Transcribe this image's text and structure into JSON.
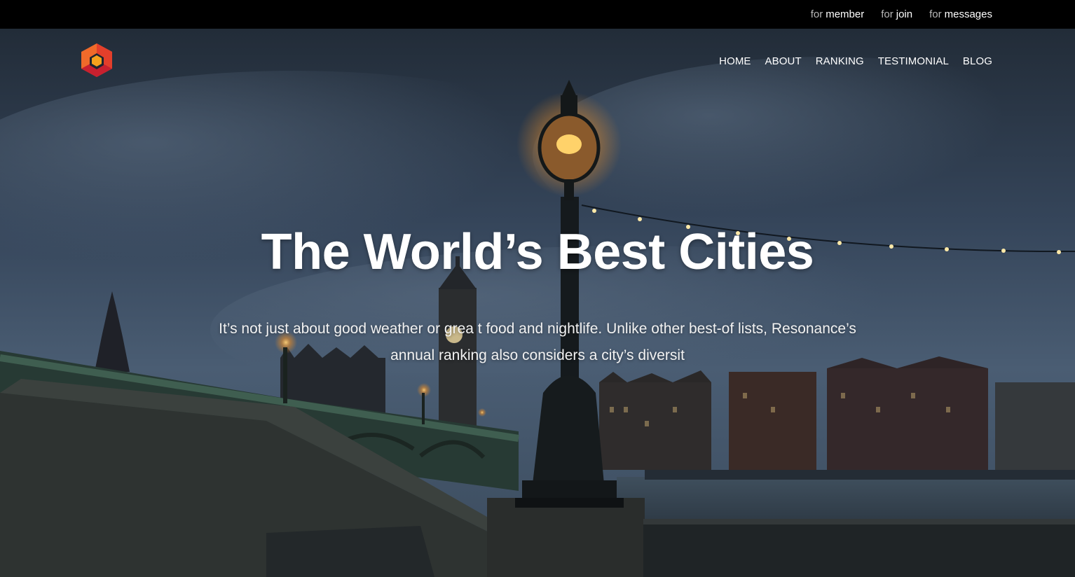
{
  "topbar": {
    "links": [
      {
        "prefix": "for",
        "label": "member"
      },
      {
        "prefix": "for",
        "label": "join"
      },
      {
        "prefix": "for",
        "label": "messages"
      }
    ]
  },
  "nav": {
    "items": [
      "HOME",
      "ABOUT",
      "RANKING",
      "TESTIMONIAL",
      "BLOG"
    ]
  },
  "hero": {
    "title": "The World’s Best Cities",
    "subtitle": "It’s not just about good weather or grea t food and nightlife. Unlike other best-of lists, Resonance’s annual ranking also considers a city’s diversit"
  },
  "colors": {
    "topbar_bg": "#000000",
    "sky": "#3b4c5e",
    "logo_orange": "#f06a2a",
    "logo_red": "#d8272f",
    "logo_yellow": "#f6a21c"
  }
}
